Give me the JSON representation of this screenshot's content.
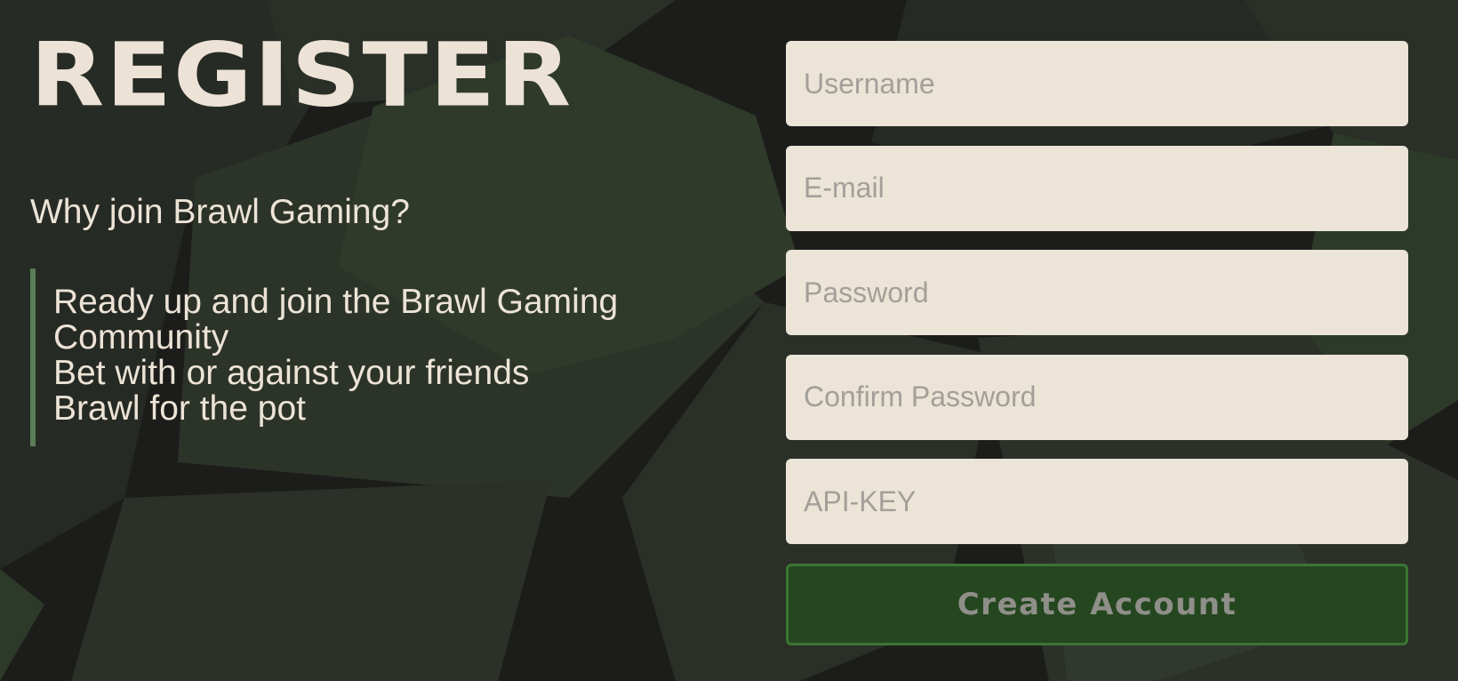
{
  "colors": {
    "background": "#1c1d1b",
    "text": "#ece3d6",
    "accent_bar": "#5a7d57",
    "field_bg": "#ebe4d7",
    "placeholder": "#a39f99",
    "button_bg": "#254720",
    "button_border": "#3b7534",
    "button_text": "#8f8f89"
  },
  "header": {
    "title": "REGISTER"
  },
  "intro": {
    "question": "Why join Brawl Gaming?",
    "features": [
      "Ready up and join the Brawl Gaming Community",
      "Bet with or against your friends",
      "Brawl for the pot"
    ]
  },
  "form": {
    "username_placeholder": "Username",
    "email_placeholder": "E-mail",
    "password_placeholder": "Password",
    "confirm_password_placeholder": "Confirm Password",
    "api_key_placeholder": "API-KEY",
    "submit_label": "Create Account"
  }
}
